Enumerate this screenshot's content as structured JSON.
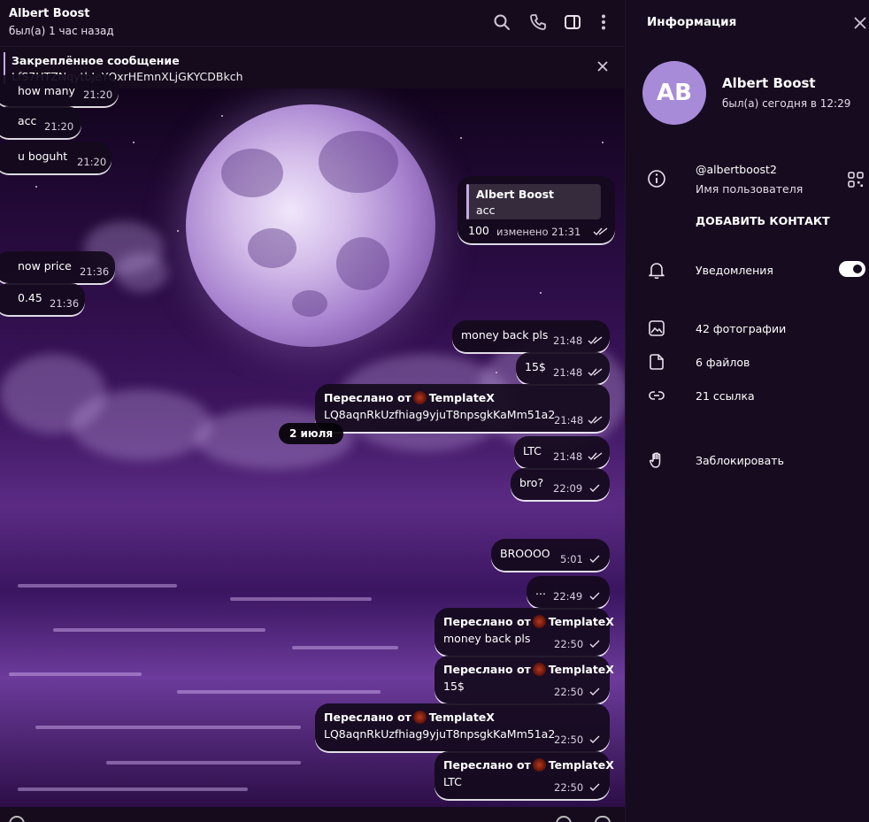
{
  "chat": {
    "name": "Albert Boost",
    "status": "был(а) 1 час назад",
    "header_icons": [
      "search-icon",
      "phone-icon",
      "sidebar-toggle-icon",
      "more-vertical-icon"
    ],
    "pinned": {
      "title": "Закреплённое сообщение",
      "text": "LfS7HTZNqytbJeYQxrHEmnXLjGKYCDBkch"
    },
    "date_separator": "2 июля",
    "messages": [
      {
        "text": "how many",
        "time": "21:20"
      },
      {
        "text": "acc",
        "time": "21:20"
      },
      {
        "text": "u boguht",
        "time": "21:20"
      },
      {
        "reply_name": "Albert Boost",
        "reply_text": "acc",
        "text": "100",
        "time": "изменено 21:31"
      },
      {
        "text": "now price",
        "time": "21:36"
      },
      {
        "text": "0.45",
        "time": "21:36"
      },
      {
        "text": "money back pls",
        "time": "21:48"
      },
      {
        "text": "15$",
        "time": "21:48"
      },
      {
        "forward_label": "Переслано от",
        "forward_from": "TemplateX",
        "text": "LQ8aqnRkUzfhiag9yjuT8npsgkKaMm51a2",
        "time": "21:48"
      },
      {
        "text": "LTC",
        "time": "21:48"
      },
      {
        "text": "bro?",
        "time": "22:09"
      },
      {
        "text": "BROOOO",
        "time": "5:01"
      },
      {
        "text": "...",
        "time": "22:49"
      },
      {
        "forward_label": "Переслано от",
        "forward_from": "TemplateX",
        "text": "money back pls",
        "time": "22:50"
      },
      {
        "forward_label": "Переслано от",
        "forward_from": "TemplateX",
        "text": "15$",
        "time": "22:50"
      },
      {
        "forward_label": "Переслано от",
        "forward_from": "TemplateX",
        "text": "LQ8aqnRkUzfhiag9yjuT8npsgkKaMm51a2",
        "time": "22:50"
      },
      {
        "forward_label": "Переслано от",
        "forward_from": "TemplateX",
        "text": "LTC",
        "time": "22:50"
      }
    ]
  },
  "info": {
    "title": "Информация",
    "avatar_initials": "AB",
    "avatar_color": "#a78bd9",
    "name": "Albert Boost",
    "status": "был(а) сегодня в 12:29",
    "username": "@albertboost2",
    "username_label": "Имя пользователя",
    "add_contact": "ДОБАВИТЬ КОНТАКТ",
    "notifications": "Уведомления",
    "notifications_enabled": true,
    "photos": "42 фотографии",
    "files": "6 файлов",
    "links": "21 ссылка",
    "block": "Заблокировать"
  }
}
